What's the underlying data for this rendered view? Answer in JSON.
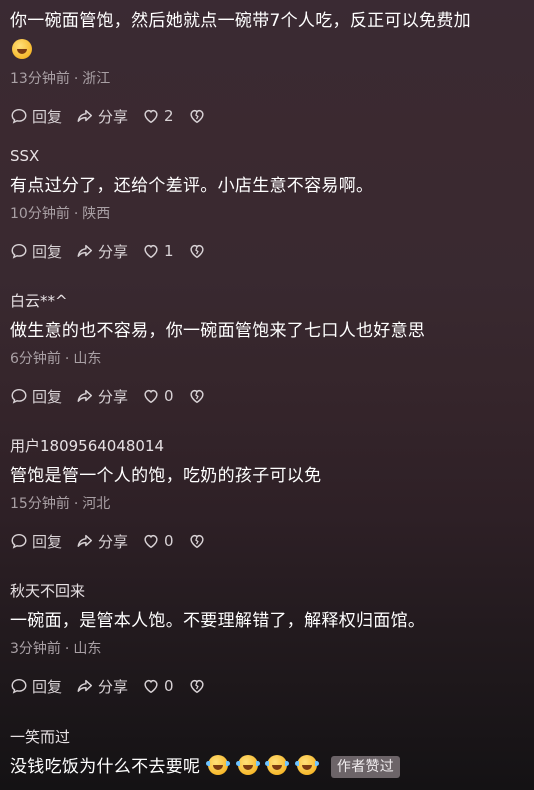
{
  "comments": [
    {
      "username": "",
      "content": "你一碗面管饱，然后她就点一碗带7个人吃，反正可以免费加",
      "time": "13分钟前",
      "location": "浙江",
      "reply_label": "回复",
      "share_label": "分享",
      "like_count": "2"
    },
    {
      "username": "SSX",
      "content": "有点过分了，还给个差评。小店生意不容易啊。",
      "time": "10分钟前",
      "location": "陕西",
      "reply_label": "回复",
      "share_label": "分享",
      "like_count": "1"
    },
    {
      "username": "白云**^",
      "content": "做生意的也不容易，你一碗面管饱来了七口人也好意思",
      "time": "6分钟前",
      "location": "山东",
      "reply_label": "回复",
      "share_label": "分享",
      "like_count": "0"
    },
    {
      "username": "用户1809564048014",
      "content": "管饱是管一个人的饱，吃奶的孩子可以免",
      "time": "15分钟前",
      "location": "河北",
      "reply_label": "回复",
      "share_label": "分享",
      "like_count": "0"
    },
    {
      "username": "秋天不回来",
      "content": "一碗面，是管本人饱。不要理解错了，解释权归面馆。",
      "time": "3分钟前",
      "location": "山东",
      "reply_label": "回复",
      "share_label": "分享",
      "like_count": "0"
    },
    {
      "username": "一笑而过",
      "content": "没钱吃饭为什么不去要呢",
      "badge": "作者赞过"
    }
  ],
  "separator": "·",
  "icons": {
    "reply": "comment-bubble-icon",
    "share": "share-arrow-icon",
    "like": "heart-icon",
    "dislike": "broken-heart-icon",
    "emoji_first": "grinning-face-emoji",
    "emoji_last": "rolling-laughing-emoji"
  }
}
